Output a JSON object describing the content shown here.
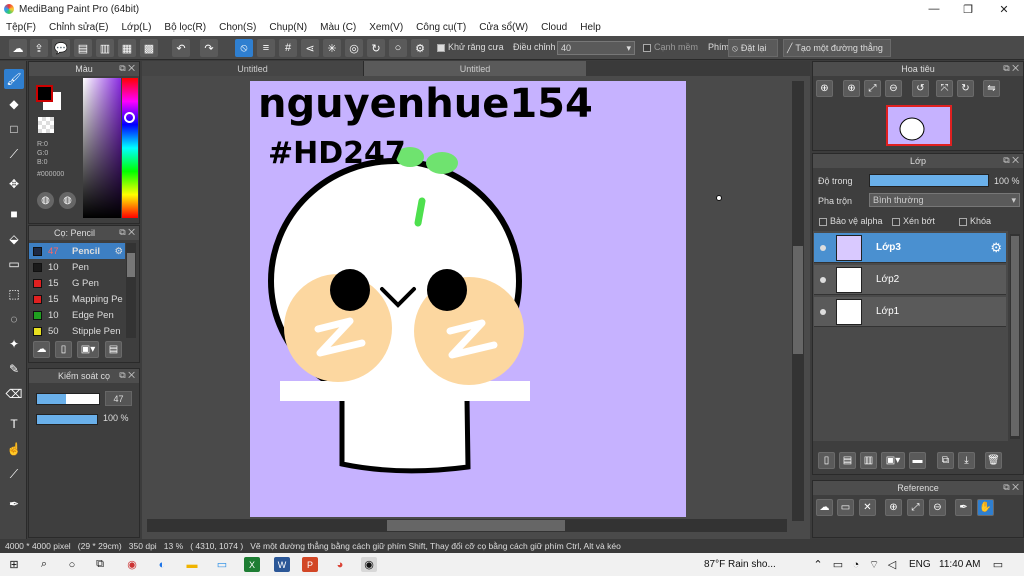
{
  "titlebar": {
    "title": "MediBang Paint Pro (64bit)",
    "minimize": "—",
    "maximize": "❐",
    "close": "✕"
  },
  "menu": [
    "Tệp(F)",
    "Chỉnh sửa(E)",
    "Lớp(L)",
    "Bộ lọc(R)",
    "Chọn(S)",
    "Chụp(N)",
    "Màu (C)",
    "Xem(V)",
    "Công cụ(T)",
    "Cửa sổ(W)",
    "Cloud",
    "Help"
  ],
  "toolbar": {
    "antialias_label": "Khử răng cưa",
    "correction_label": "Điều chỉnh",
    "correction_value": "40",
    "soft_edge_label": "Cạnh mềm",
    "key_label": "Phím",
    "reset_label": "Đặt lại",
    "line_label": "Tạo một đường thẳng"
  },
  "tabs": [
    "Untitled",
    "Untitled"
  ],
  "color_panel": {
    "title": "Màu",
    "r": "R:0",
    "g": "G:0",
    "b": "B:0",
    "hex": "#000000",
    "primary": "#000000",
    "secondary": "#ffffff",
    "accent": "#2f7fd0"
  },
  "brush_panel": {
    "title": "Cọ: Pencil",
    "items": [
      {
        "size": "47",
        "name": "Pencil",
        "color": "#1e2a44"
      },
      {
        "size": "10",
        "name": "Pen",
        "color": "#1a1a1a"
      },
      {
        "size": "15",
        "name": "G Pen",
        "color": "#e02020"
      },
      {
        "size": "15",
        "name": "Mapping Pe",
        "color": "#e02020"
      },
      {
        "size": "10",
        "name": "Edge Pen",
        "color": "#1fa01f"
      },
      {
        "size": "50",
        "name": "Stipple Pen",
        "color": "#e8e020"
      }
    ]
  },
  "brush_control": {
    "title": "Kiểm soát cọ",
    "size": "47",
    "opacity": "100 %",
    "size_fraction": 0.47,
    "opacity_fraction": 1.0
  },
  "canvas": {
    "bg": "#c6b2ff",
    "text_line1": "nguyenhue154",
    "text_line2": "#HD247",
    "leaf_color": "#6fe36f",
    "blush_color": "#fcd7a0"
  },
  "navigator": {
    "title": "Hoa tiêu"
  },
  "layers": {
    "title": "Lớp",
    "opacity_label": "Độ trong",
    "opacity_value": "100 %",
    "opacity_fraction": 1.0,
    "blend_label": "Pha trộn",
    "blend_value": "Bình thường",
    "protect_alpha": "Bảo vệ alpha",
    "clipping": "Xén bớt",
    "lock": "Khóa",
    "items": [
      {
        "name": "Lớp3"
      },
      {
        "name": "Lớp2"
      },
      {
        "name": "Lớp1"
      }
    ]
  },
  "reference": {
    "title": "Reference"
  },
  "status": {
    "text": "4000 * 4000 pixel   (29 * 29cm)   350 dpi   13 %   ( 4310, 1074 )   Vẽ một đường thẳng bằng cách giữ phím Shift, Thay đổi cỡ cọ bằng cách giữ phím Ctrl, Alt và kéo"
  },
  "taskbar": {
    "weather": "87°F  Rain sho...",
    "lang": "ENG",
    "time": "11:40 AM"
  }
}
